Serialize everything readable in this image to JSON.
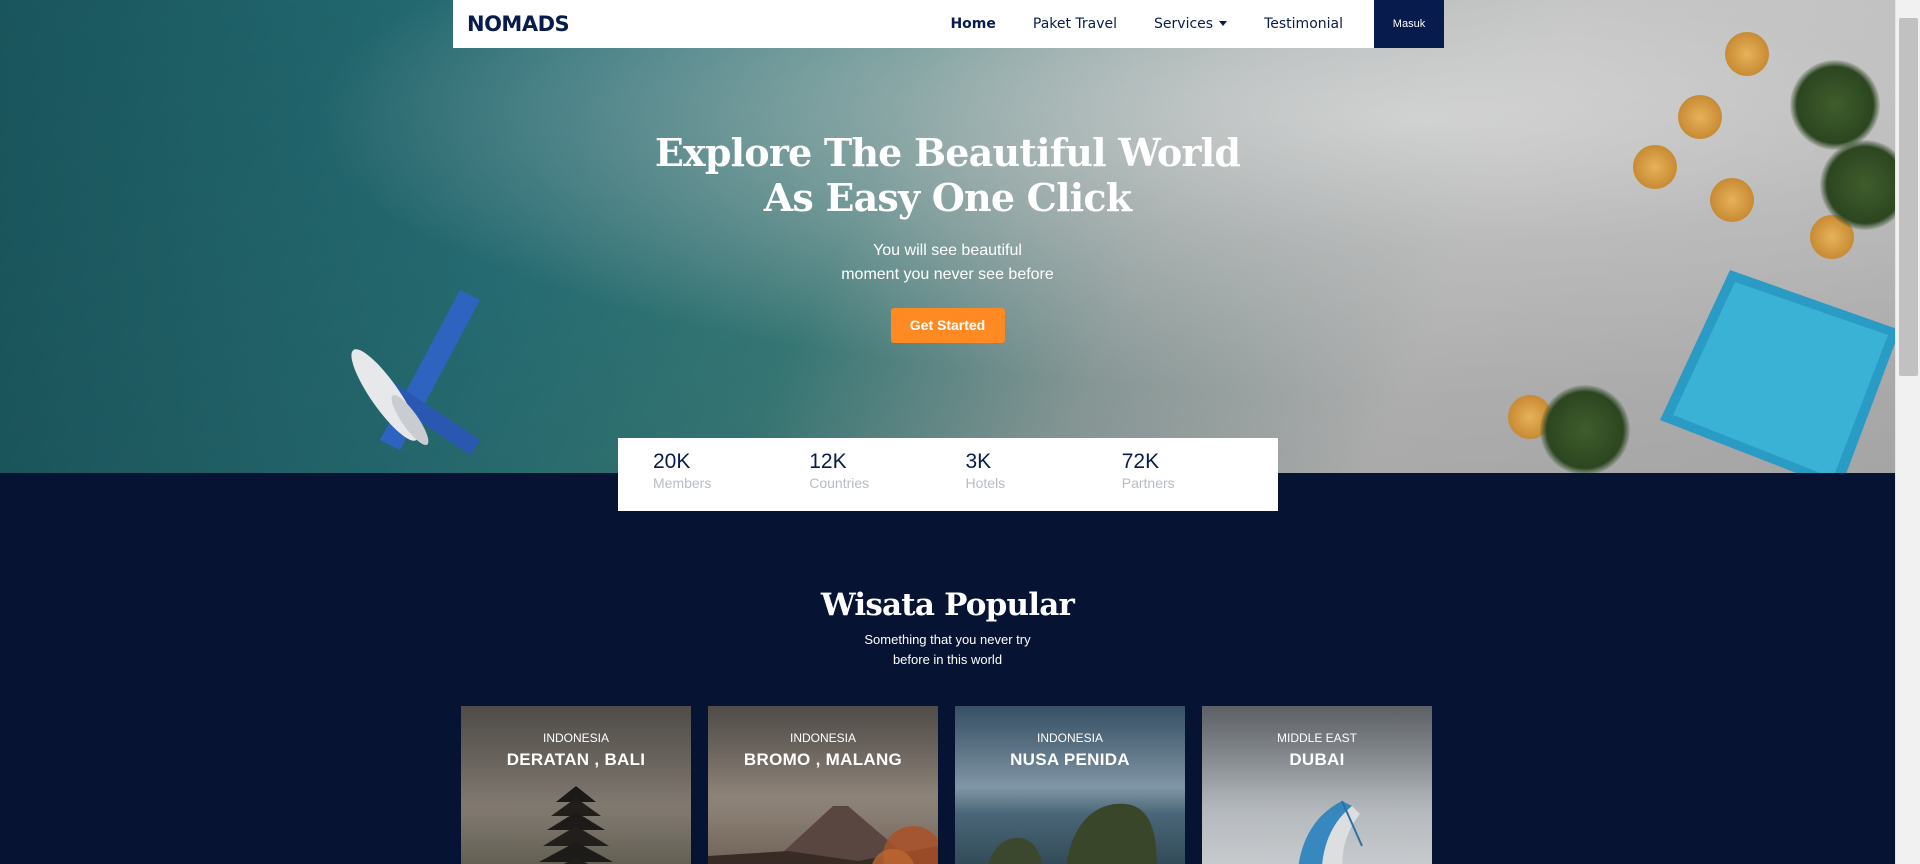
{
  "navbar": {
    "brand": "NOMADS",
    "links": [
      {
        "label": "Home",
        "active": true
      },
      {
        "label": "Paket Travel"
      },
      {
        "label": "Services",
        "dropdown": true
      },
      {
        "label": "Testimonial"
      }
    ],
    "login_label": "Masuk"
  },
  "hero": {
    "title_line1": "Explore The Beautiful World",
    "title_line2": "As Easy One Click",
    "sub_line1": "You will see beautiful",
    "sub_line2": "moment you never see before",
    "cta_label": "Get Started",
    "cta_color": "#ff8a24"
  },
  "stats": [
    {
      "value": "20K",
      "label": "Members"
    },
    {
      "value": "12K",
      "label": "Countries"
    },
    {
      "value": "3K",
      "label": "Hotels"
    },
    {
      "value": "72K",
      "label": "Partners"
    }
  ],
  "popular": {
    "title": "Wisata Popular",
    "sub_line1": "Something that you never try",
    "sub_line2": "before in this world",
    "cards": [
      {
        "country": "INDONESIA",
        "name": "DERATAN , BALI"
      },
      {
        "country": "INDONESIA",
        "name": "BROMO , MALANG"
      },
      {
        "country": "INDONESIA",
        "name": "NUSA PENIDA"
      },
      {
        "country": "MIDDLE EAST",
        "name": "DUBAI"
      }
    ]
  },
  "colors": {
    "navy": "#071333",
    "brand_navy": "#071c4d",
    "accent_orange": "#ff8a24"
  }
}
